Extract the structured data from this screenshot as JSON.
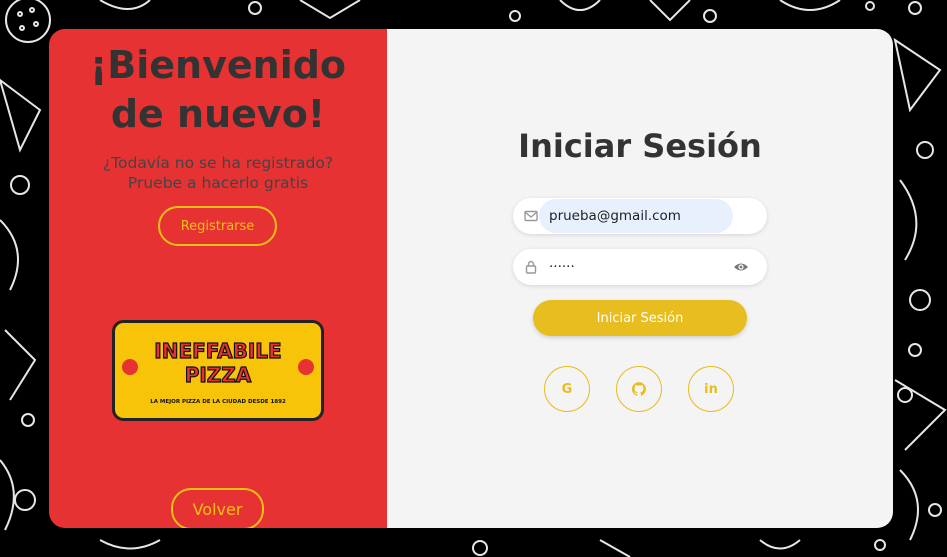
{
  "left_panel": {
    "welcome_line1": "¡Bienvenido",
    "welcome_line2": "de nuevo!",
    "subtitle_line1": "¿Todavía no se ha registrado?",
    "subtitle_line2": "Pruebe a hacerlo gratis",
    "register_button": "Registrarse",
    "back_button": "Volver",
    "logo": {
      "name_line1": "INEFFABILE",
      "name_line2": "PIZZA",
      "tagline": "LA MEJOR PIZZA DE LA CIUDAD DESDE 1892"
    }
  },
  "login": {
    "title": "Iniciar Sesión",
    "email_value": "prueba@gmail.com",
    "password_mask": "······",
    "submit_button": "Iniciar Sesión",
    "social": [
      {
        "icon": "google-icon",
        "glyph": "G"
      },
      {
        "icon": "github-icon",
        "glyph": "gh"
      },
      {
        "icon": "linkedin-icon",
        "glyph": "in"
      }
    ]
  },
  "colors": {
    "left_panel_bg": "#e63232",
    "right_panel_bg": "#f4f4f4",
    "accent_yellow": "#e7bd1f",
    "page_bg": "#000000"
  }
}
